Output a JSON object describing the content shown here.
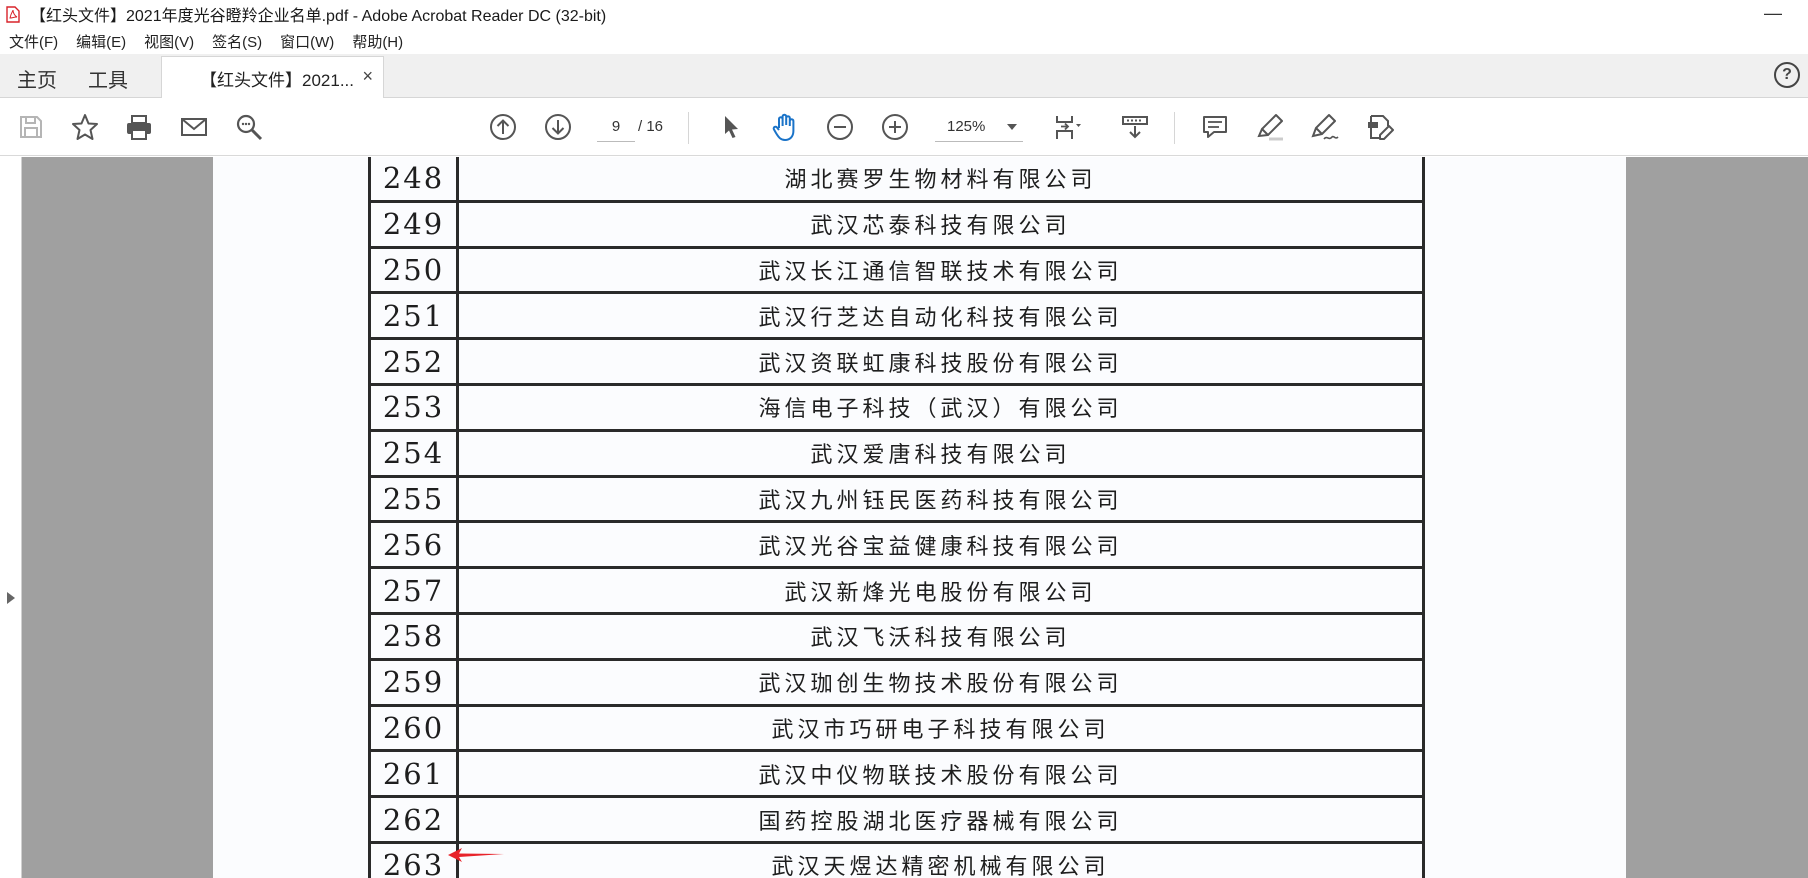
{
  "window": {
    "title": "【红头文件】2021年度光谷瞪羚企业名单.pdf - Adobe Acrobat Reader DC (32-bit)",
    "minimize": "—"
  },
  "menu": [
    "文件(F)",
    "编辑(E)",
    "视图(V)",
    "签名(S)",
    "窗口(W)",
    "帮助(H)"
  ],
  "tabs": {
    "home": "主页",
    "tools": "工具",
    "document": "【红头文件】2021...",
    "close": "×",
    "help": "?"
  },
  "toolbar": {
    "page_current": "9",
    "page_total": "/ 16",
    "zoom": "125%"
  },
  "icons": {
    "save": "save-icon",
    "bookmark": "star-icon",
    "print": "printer-icon",
    "email": "envelope-icon",
    "search": "magnifier-icon",
    "prev_page": "arrow-up-circle-icon",
    "next_page": "arrow-down-circle-icon",
    "select": "cursor-icon",
    "hand": "hand-icon",
    "zoom_out": "minus-circle-icon",
    "zoom_in": "plus-circle-icon",
    "fit": "page-fit-icon",
    "scroll_mode": "scroll-mode-icon",
    "comment": "comment-icon",
    "highlight": "highlight-pen-icon",
    "sign": "sign-pen-icon",
    "edit_doc": "edit-document-icon"
  },
  "colors": {
    "accent_blue": "#1a73c8",
    "annotation_red": "#e8232a"
  },
  "document": {
    "rows": [
      {
        "num": "248",
        "name": "湖北赛罗生物材料有限公司"
      },
      {
        "num": "249",
        "name": "武汉芯泰科技有限公司"
      },
      {
        "num": "250",
        "name": "武汉长江通信智联技术有限公司"
      },
      {
        "num": "251",
        "name": "武汉行芝达自动化科技有限公司"
      },
      {
        "num": "252",
        "name": "武汉资联虹康科技股份有限公司"
      },
      {
        "num": "253",
        "name": "海信电子科技（武汉）有限公司"
      },
      {
        "num": "254",
        "name": "武汉爱唐科技有限公司"
      },
      {
        "num": "255",
        "name": "武汉九州钰民医药科技有限公司"
      },
      {
        "num": "256",
        "name": "武汉光谷宝益健康科技有限公司"
      },
      {
        "num": "257",
        "name": "武汉新烽光电股份有限公司"
      },
      {
        "num": "258",
        "name": "武汉飞沃科技有限公司"
      },
      {
        "num": "259",
        "name": "武汉珈创生物技术股份有限公司"
      },
      {
        "num": "260",
        "name": "武汉市巧研电子科技有限公司"
      },
      {
        "num": "261",
        "name": "武汉中仪物联技术股份有限公司"
      },
      {
        "num": "262",
        "name": "国药控股湖北医疗器械有限公司"
      },
      {
        "num": "263",
        "name": "武汉天煜达精密机械有限公司"
      }
    ]
  }
}
